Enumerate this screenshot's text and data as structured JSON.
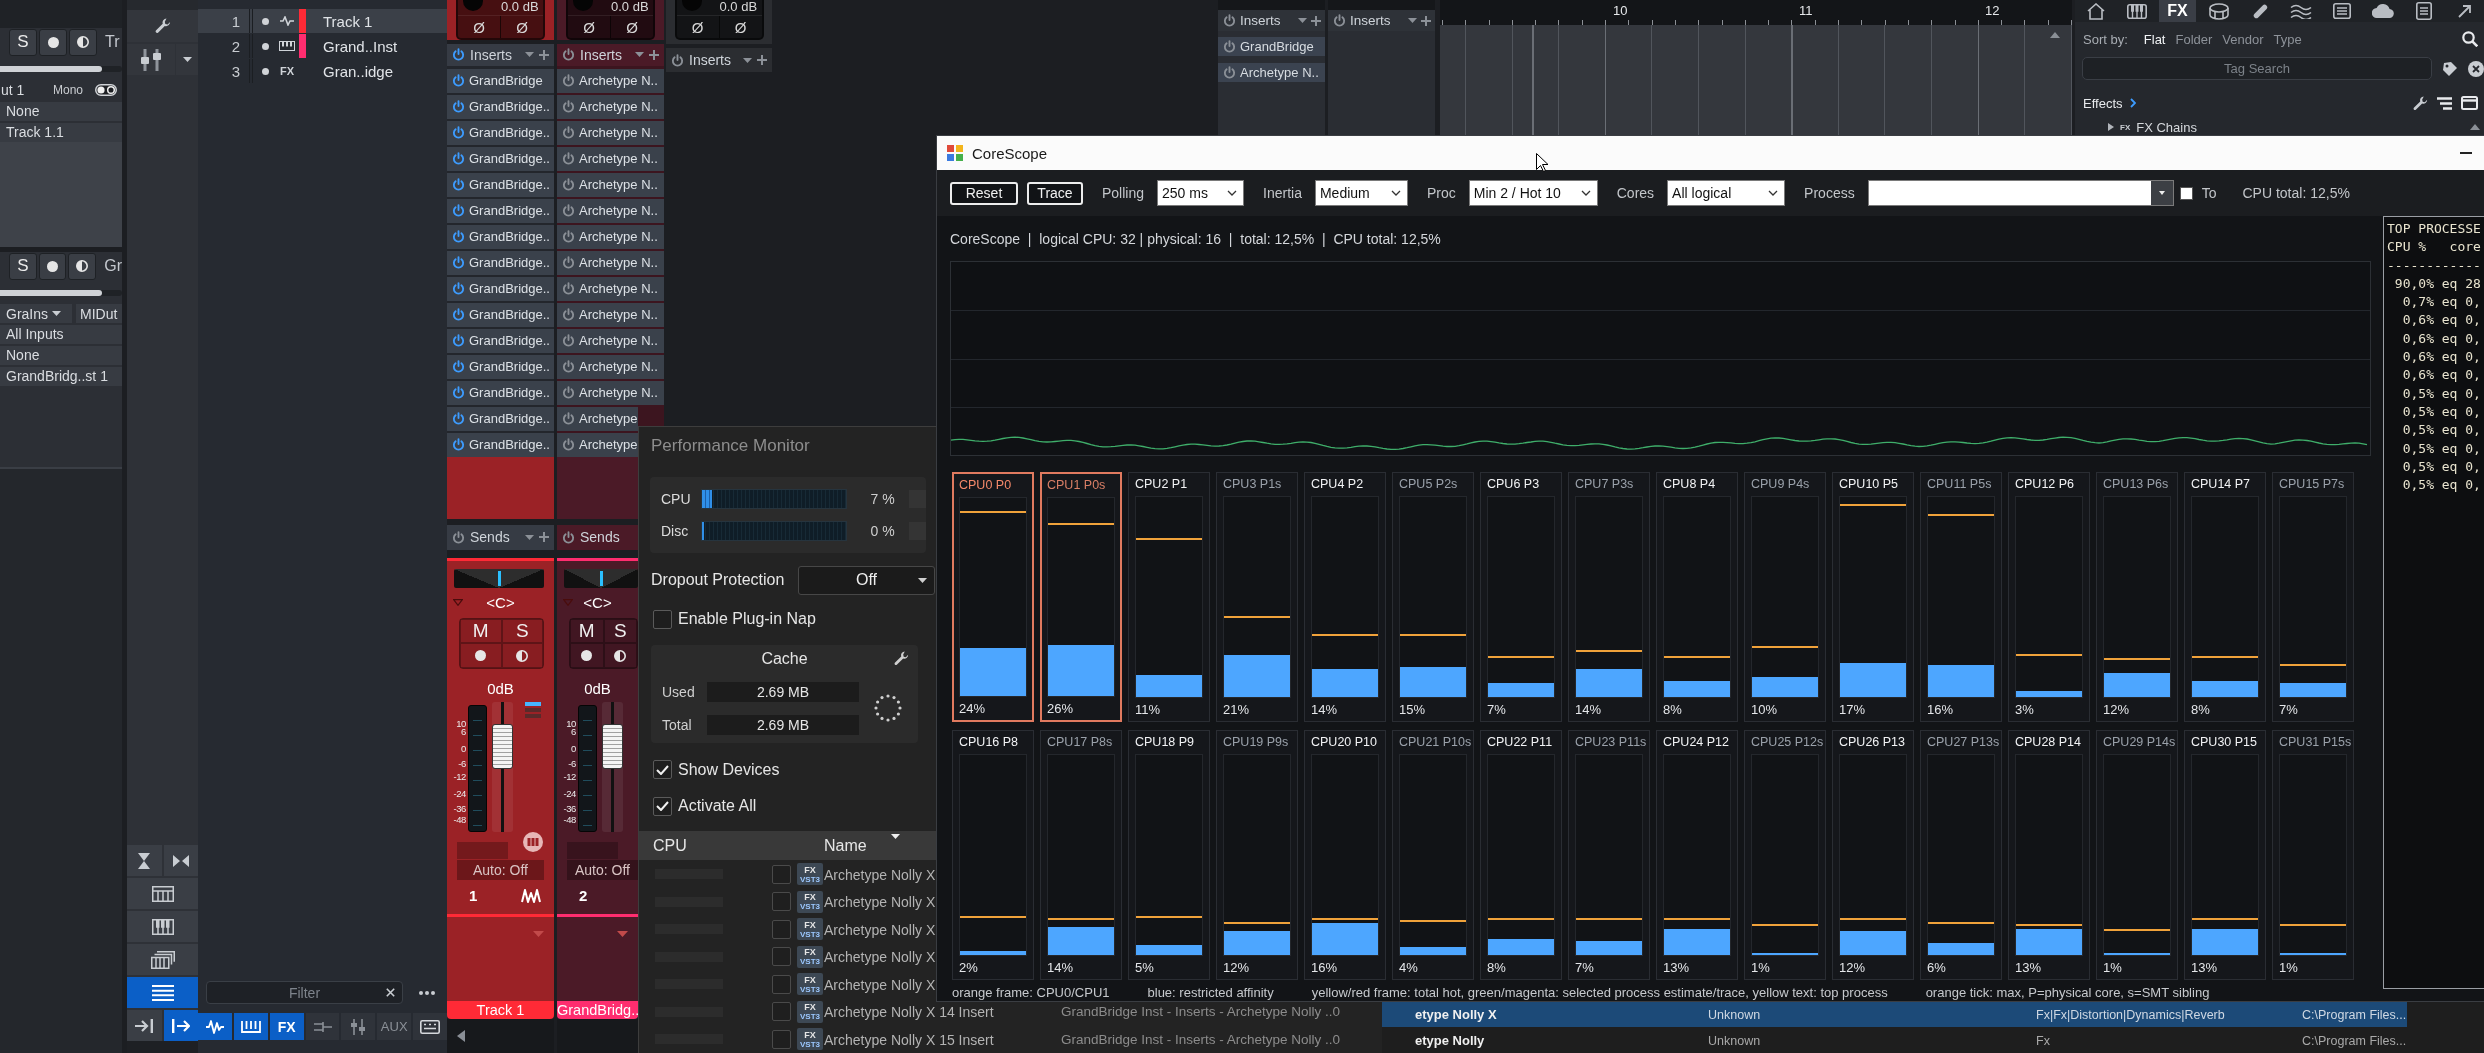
{
  "inspector": {
    "sections": [
      {
        "solo": "S",
        "track_name": "Tr",
        "volume": {
          "level": 0.84
        },
        "rows": [
          {
            "kind": "io",
            "label": "ut 1",
            "mode": "Mono"
          },
          {
            "kind": "value",
            "text": "None"
          },
          {
            "kind": "value",
            "text": "Track 1.1"
          }
        ]
      },
      {
        "solo": "S",
        "track_name": "Gr",
        "volume": {
          "level": 0.84
        },
        "rows": [
          {
            "kind": "pair",
            "left": "GraIns",
            "right": "MIDut"
          },
          {
            "kind": "value",
            "text": "All Inputs"
          },
          {
            "kind": "value",
            "text": "None"
          },
          {
            "kind": "value",
            "text": "GrandBridg..st 1"
          }
        ]
      }
    ]
  },
  "tools": {
    "top": [
      {
        "kind": "wrench"
      },
      {
        "kind": "mixer"
      }
    ],
    "bottom": [
      {
        "kind": "collapse",
        "selected": false
      },
      {
        "kind": "expand",
        "selected": false
      },
      {
        "kind": "grid",
        "selected": false
      },
      {
        "kind": "keys",
        "selected": false
      },
      {
        "kind": "stack",
        "selected": false
      },
      {
        "kind": "list",
        "selected": true
      },
      {
        "kind": "in",
        "selected": false
      },
      {
        "kind": "out",
        "selected": true
      }
    ]
  },
  "track_list": {
    "tracks": [
      {
        "number": "1",
        "kind": "audio",
        "name": "Track 1",
        "color": "#ff2a36",
        "selected": true
      },
      {
        "number": "2",
        "kind": "instrument",
        "name": "Grand..Inst",
        "color": "#ff2d6f",
        "selected": false
      },
      {
        "number": "3",
        "kind": "fx",
        "type_label": "FX",
        "name": "Gran..idge",
        "selected": false
      }
    ],
    "filter": {
      "placeholder": "Filter"
    },
    "tabs": [
      {
        "kind": "audio",
        "selected": true
      },
      {
        "kind": "instrument",
        "selected": true
      },
      {
        "kind": "fx",
        "label": "FX",
        "selected": true
      },
      {
        "kind": "bus",
        "selected": false
      },
      {
        "kind": "vca",
        "selected": false
      },
      {
        "kind": "aux",
        "label": "AUX",
        "selected": false
      },
      {
        "kind": "input",
        "selected": false
      }
    ]
  },
  "mixer": {
    "channels": [
      {
        "kind": "full",
        "selected": true,
        "color": "#9b2226",
        "gain": "0.0 dB",
        "phase": [
          "Ø",
          "Ø"
        ],
        "inserts": {
          "label": "Inserts",
          "on": true,
          "slots": [
            {
              "name": "GrandBridge",
              "on": true
            },
            {
              "name": "GrandBridge..",
              "on": true
            },
            {
              "name": "GrandBridge..",
              "on": true
            },
            {
              "name": "GrandBridge..",
              "on": true
            },
            {
              "name": "GrandBridge..",
              "on": true
            },
            {
              "name": "GrandBridge..",
              "on": true
            },
            {
              "name": "GrandBridge..",
              "on": true
            },
            {
              "name": "GrandBridge..",
              "on": true
            },
            {
              "name": "GrandBridge..",
              "on": true
            },
            {
              "name": "GrandBridge..",
              "on": true
            },
            {
              "name": "GrandBridge..",
              "on": true
            },
            {
              "name": "GrandBridge..",
              "on": true
            },
            {
              "name": "GrandBridge..",
              "on": true
            },
            {
              "name": "GrandBridge..",
              "on": true
            },
            {
              "name": "GrandBridge..",
              "on": true
            }
          ]
        },
        "sends": {
          "label": "Sends",
          "on": false
        },
        "pan": {
          "label": "<C>",
          "level": 0.5
        },
        "mute": "M",
        "solo": "S",
        "volume": "0dB",
        "scale": [
          "10",
          "6",
          "0",
          "-6",
          "-12",
          "-24",
          "-36",
          "-48"
        ],
        "fader": {
          "level": 0.74
        },
        "automation": "Auto: Off",
        "number": "1",
        "name_tag": {
          "text": "Track 1",
          "color": "#ff2a36"
        }
      },
      {
        "kind": "full",
        "selected": false,
        "color": "#4b1a27",
        "gain": "0.0 dB",
        "phase": [
          "Ø",
          "Ø"
        ],
        "inserts": {
          "label": "Inserts",
          "on": false,
          "slots": [
            {
              "name": "Archetype N..",
              "on": false
            },
            {
              "name": "Archetype N..",
              "on": false
            },
            {
              "name": "Archetype N..",
              "on": false
            },
            {
              "name": "Archetype N..",
              "on": false
            },
            {
              "name": "Archetype N..",
              "on": false
            },
            {
              "name": "Archetype N..",
              "on": false
            },
            {
              "name": "Archetype N..",
              "on": false
            },
            {
              "name": "Archetype N..",
              "on": false
            },
            {
              "name": "Archetype N..",
              "on": false
            },
            {
              "name": "Archetype N..",
              "on": false
            },
            {
              "name": "Archetype N..",
              "on": false
            },
            {
              "name": "Archetype N..",
              "on": false
            },
            {
              "name": "Archetype N..",
              "on": false
            },
            {
              "name": "Archetype",
              "on": false
            },
            {
              "name": "Archetype",
              "on": false
            }
          ]
        },
        "sends": {
          "label": "Sends",
          "on": false
        },
        "pan": {
          "label": "<C>",
          "level": 0.5
        },
        "mute": "M",
        "solo": "S",
        "volume": "0dB",
        "scale": [
          "10",
          "6",
          "0",
          "-6",
          "-12",
          "-24",
          "-36",
          "-48"
        ],
        "fader": {
          "level": 0.74
        },
        "automation": "Auto: Off",
        "number": "2",
        "name_tag": {
          "text": "GrandBridg..",
          "color": "#ff2d6f"
        }
      },
      {
        "kind": "header",
        "selected": false,
        "color": "#2b2d31",
        "gain": "0.0 dB",
        "phase": [
          "Ø",
          "Ø"
        ],
        "inserts": {
          "label": "Inserts",
          "on": false
        }
      }
    ]
  },
  "upper_strips": [
    {
      "inserts": {
        "label": "Inserts",
        "on": false,
        "slots": [
          {
            "name": "GrandBridge",
            "on": false
          },
          {
            "name": "Archetype N..",
            "on": false
          }
        ]
      }
    },
    {
      "inserts": {
        "label": "Inserts",
        "on": false
      }
    }
  ],
  "timeline": {
    "bars": [
      "10",
      "11",
      "12"
    ]
  },
  "browser": {
    "tabs": [
      {
        "kind": "home",
        "selected": false
      },
      {
        "kind": "instruments",
        "selected": false
      },
      {
        "kind": "effects",
        "label": "FX",
        "selected": true
      },
      {
        "kind": "loops",
        "selected": false
      },
      {
        "kind": "patterns",
        "selected": false
      },
      {
        "kind": "sounds",
        "selected": false
      },
      {
        "kind": "files",
        "selected": false
      },
      {
        "kind": "cloud",
        "selected": false
      },
      {
        "kind": "pool",
        "selected": false
      },
      {
        "kind": "export",
        "selected": false
      }
    ],
    "sort": {
      "label": "Sort by:",
      "options": [
        {
          "label": "Flat",
          "selected": true
        },
        {
          "label": "Folder",
          "selected": false
        },
        {
          "label": "Vendor",
          "selected": false
        },
        {
          "label": "Type",
          "selected": false
        }
      ]
    },
    "search": {
      "placeholder": "Tag Search"
    },
    "path": "Effects",
    "tree": [
      {
        "type_label": "FX",
        "label": "FX Chains",
        "expanded": false
      }
    ]
  },
  "perf_monitor": {
    "title": "Performance Monitor",
    "meters": [
      {
        "label": "CPU",
        "level": 0.07,
        "reading": "7 %"
      },
      {
        "label": "Disc",
        "level": 0,
        "reading": "0 %"
      }
    ],
    "dropout": {
      "label": "Dropout Protection",
      "value": "Off"
    },
    "plugin_nap": {
      "label": "Enable Plug-in Nap",
      "checked": false
    },
    "cache": {
      "title": "Cache",
      "rows": [
        {
          "label": "Used",
          "value": "2.69 MB"
        },
        {
          "label": "Total",
          "value": "2.69 MB"
        }
      ]
    },
    "device_options": [
      {
        "label": "Show Devices",
        "checked": true
      },
      {
        "label": "Activate All",
        "checked": true
      }
    ],
    "table": {
      "columns": [
        "CPU",
        "Name"
      ],
      "rows": [
        {
          "checked": false,
          "badge": "FX",
          "format": "VST3",
          "name": "Archetype Nolly X"
        },
        {
          "checked": false,
          "badge": "FX",
          "format": "VST3",
          "name": "Archetype Nolly X"
        },
        {
          "checked": false,
          "badge": "FX",
          "format": "VST3",
          "name": "Archetype Nolly X"
        },
        {
          "checked": false,
          "badge": "FX",
          "format": "VST3",
          "name": "Archetype Nolly X"
        },
        {
          "checked": false,
          "badge": "FX",
          "format": "VST3",
          "name": "Archetype Nolly X"
        },
        {
          "checked": false,
          "badge": "FX",
          "format": "VST3",
          "name": "Archetype Nolly X 14 Insert",
          "location": "GrandBridge Inst - Inserts - Archetype Nolly ..0"
        },
        {
          "checked": false,
          "badge": "FX",
          "format": "VST3",
          "name": "Archetype Nolly X 15 Insert",
          "location": "GrandBridge Inst - Inserts - Archetype Nolly ..0"
        }
      ]
    }
  },
  "plugin_list": {
    "rows": [
      {
        "name": "etype Nolly X",
        "vendor": "Unknown",
        "category": "Fx|Fx|Distortion|Dynamics|Reverb",
        "path": "C:\\Program Files...",
        "selected": true
      },
      {
        "name": "etype Nolly",
        "vendor": "Unknown",
        "category": "Fx",
        "path": "C:\\Program Files...",
        "selected": false
      }
    ]
  },
  "corescope": {
    "title": "CoreScope",
    "toolbar": {
      "buttons": [
        "Reset",
        "Trace"
      ],
      "dropdowns": [
        {
          "label": "Polling",
          "value": "250 ms"
        },
        {
          "label": "Inertia",
          "value": "Medium"
        },
        {
          "label": "Proc",
          "value": "Min 2 / Hot 10"
        },
        {
          "label": "Cores",
          "value": "All logical"
        }
      ],
      "process": {
        "label": "Process"
      },
      "to": {
        "label": "To",
        "checked": false
      },
      "cpu_total": "CPU total: 12,5%"
    },
    "status": "CoreScope  |  logical CPU: 32 | physical: 16  |  total: 12,5%  |  CPU total: 12,5%",
    "cores": [
      {
        "label": "CPU0 P0",
        "kind": "physical",
        "framed": true,
        "level": 0.24,
        "percent": "24%",
        "peak": {
          "level": 0.93
        }
      },
      {
        "label": "CPU1 P0s",
        "kind": "sibling",
        "framed": true,
        "level": 0.26,
        "percent": "26%",
        "peak": {
          "level": 0.87
        }
      },
      {
        "label": "CPU2 P1",
        "kind": "physical",
        "framed": false,
        "level": 0.11,
        "percent": "11%",
        "peak": {
          "level": 0.79
        }
      },
      {
        "label": "CPU3 P1s",
        "kind": "sibling",
        "framed": false,
        "level": 0.21,
        "percent": "21%",
        "peak": {
          "level": 0.4
        }
      },
      {
        "label": "CPU4 P2",
        "kind": "physical",
        "framed": false,
        "level": 0.14,
        "percent": "14%",
        "peak": {
          "level": 0.31
        }
      },
      {
        "label": "CPU5 P2s",
        "kind": "sibling",
        "framed": false,
        "level": 0.15,
        "percent": "15%",
        "peak": {
          "level": 0.31
        }
      },
      {
        "label": "CPU6 P3",
        "kind": "physical",
        "framed": false,
        "level": 0.07,
        "percent": "7%",
        "peak": {
          "level": 0.2
        }
      },
      {
        "label": "CPU7 P3s",
        "kind": "sibling",
        "framed": false,
        "level": 0.14,
        "percent": "14%",
        "peak": {
          "level": 0.23
        }
      },
      {
        "label": "CPU8 P4",
        "kind": "physical",
        "framed": false,
        "level": 0.08,
        "percent": "8%",
        "peak": {
          "level": 0.2
        }
      },
      {
        "label": "CPU9 P4s",
        "kind": "sibling",
        "framed": false,
        "level": 0.1,
        "percent": "10%",
        "peak": {
          "level": 0.25
        }
      },
      {
        "label": "CPU10 P5",
        "kind": "physical",
        "framed": false,
        "level": 0.17,
        "percent": "17%",
        "peak": {
          "level": 0.96
        }
      },
      {
        "label": "CPU11 P5s",
        "kind": "sibling",
        "framed": false,
        "level": 0.16,
        "percent": "16%",
        "peak": {
          "level": 0.91
        }
      },
      {
        "label": "CPU12 P6",
        "kind": "physical",
        "framed": false,
        "level": 0.03,
        "percent": "3%",
        "peak": {
          "level": 0.21
        }
      },
      {
        "label": "CPU13 P6s",
        "kind": "sibling",
        "framed": false,
        "level": 0.12,
        "percent": "12%",
        "peak": {
          "level": 0.19
        }
      },
      {
        "label": "CPU14 P7",
        "kind": "physical",
        "framed": false,
        "level": 0.08,
        "percent": "8%",
        "peak": {
          "level": 0.2
        }
      },
      {
        "label": "CPU15 P7s",
        "kind": "sibling",
        "framed": false,
        "level": 0.07,
        "percent": "7%",
        "peak": {
          "level": 0.16
        }
      },
      {
        "label": "CPU16 P8",
        "kind": "physical",
        "framed": false,
        "level": 0.02,
        "percent": "2%",
        "peak": {
          "level": 0.19
        }
      },
      {
        "label": "CPU17 P8s",
        "kind": "sibling",
        "framed": false,
        "level": 0.14,
        "percent": "14%",
        "peak": {
          "level": 0.18
        }
      },
      {
        "label": "CPU18 P9",
        "kind": "physical",
        "framed": false,
        "level": 0.05,
        "percent": "5%",
        "peak": {
          "level": 0.19
        }
      },
      {
        "label": "CPU19 P9s",
        "kind": "sibling",
        "framed": false,
        "level": 0.12,
        "percent": "12%",
        "peak": {
          "level": 0.16
        }
      },
      {
        "label": "CPU20 P10",
        "kind": "physical",
        "framed": false,
        "level": 0.16,
        "percent": "16%",
        "peak": {
          "level": 0.18
        }
      },
      {
        "label": "CPU21 P10s",
        "kind": "sibling",
        "framed": false,
        "level": 0.04,
        "percent": "4%",
        "peak": {
          "level": 0.17
        }
      },
      {
        "label": "CPU22 P11",
        "kind": "physical",
        "framed": false,
        "level": 0.08,
        "percent": "8%",
        "peak": {
          "level": 0.18
        }
      },
      {
        "label": "CPU23 P11s",
        "kind": "sibling",
        "framed": false,
        "level": 0.07,
        "percent": "7%",
        "peak": {
          "level": 0.18
        }
      },
      {
        "label": "CPU24 P12",
        "kind": "physical",
        "framed": false,
        "level": 0.13,
        "percent": "13%",
        "peak": {
          "level": 0.18
        }
      },
      {
        "label": "CPU25 P12s",
        "kind": "sibling",
        "framed": false,
        "level": 0.01,
        "percent": "1%",
        "peak": {
          "level": 0.15
        }
      },
      {
        "label": "CPU26 P13",
        "kind": "physical",
        "framed": false,
        "level": 0.12,
        "percent": "12%",
        "peak": {
          "level": 0.18
        }
      },
      {
        "label": "CPU27 P13s",
        "kind": "sibling",
        "framed": false,
        "level": 0.06,
        "percent": "6%",
        "peak": {
          "level": 0.16
        }
      },
      {
        "label": "CPU28 P14",
        "kind": "physical",
        "framed": false,
        "level": 0.13,
        "percent": "13%",
        "peak": {
          "level": 0.15
        }
      },
      {
        "label": "CPU29 P14s",
        "kind": "sibling",
        "framed": false,
        "level": 0.01,
        "percent": "1%",
        "peak": {
          "level": 0.125
        }
      },
      {
        "label": "CPU30 P15",
        "kind": "physical",
        "framed": false,
        "level": 0.13,
        "percent": "13%",
        "peak": {
          "level": 0.18
        }
      },
      {
        "label": "CPU31 P15s",
        "kind": "sibling",
        "framed": false,
        "level": 0.01,
        "percent": "1%",
        "peak": {
          "level": 0.15
        }
      }
    ],
    "legend": [
      "orange frame: CPU0/CPU1",
      "blue: restricted affinity",
      "yellow/red frame: total hot, green/magenta: selected process estimate/trace, yellow text: top process",
      "orange tick: max, P=physical core, s=SMT sibling"
    ],
    "top_processes": [
      "TOP PROCESSE",
      "CPU %   core",
      "------------",
      " 90,0% eq 28",
      "  0,7% eq 0,",
      "  0,6% eq 0,",
      "  0,6% eq 0,",
      "  0,6% eq 0,",
      "  0,6% eq 0,",
      "  0,5% eq 0,",
      "  0,5% eq 0,",
      "  0,5% eq 0,",
      "  0,5% eq 0,",
      "  0,5% eq 0,",
      "  0,5% eq 0,"
    ]
  }
}
